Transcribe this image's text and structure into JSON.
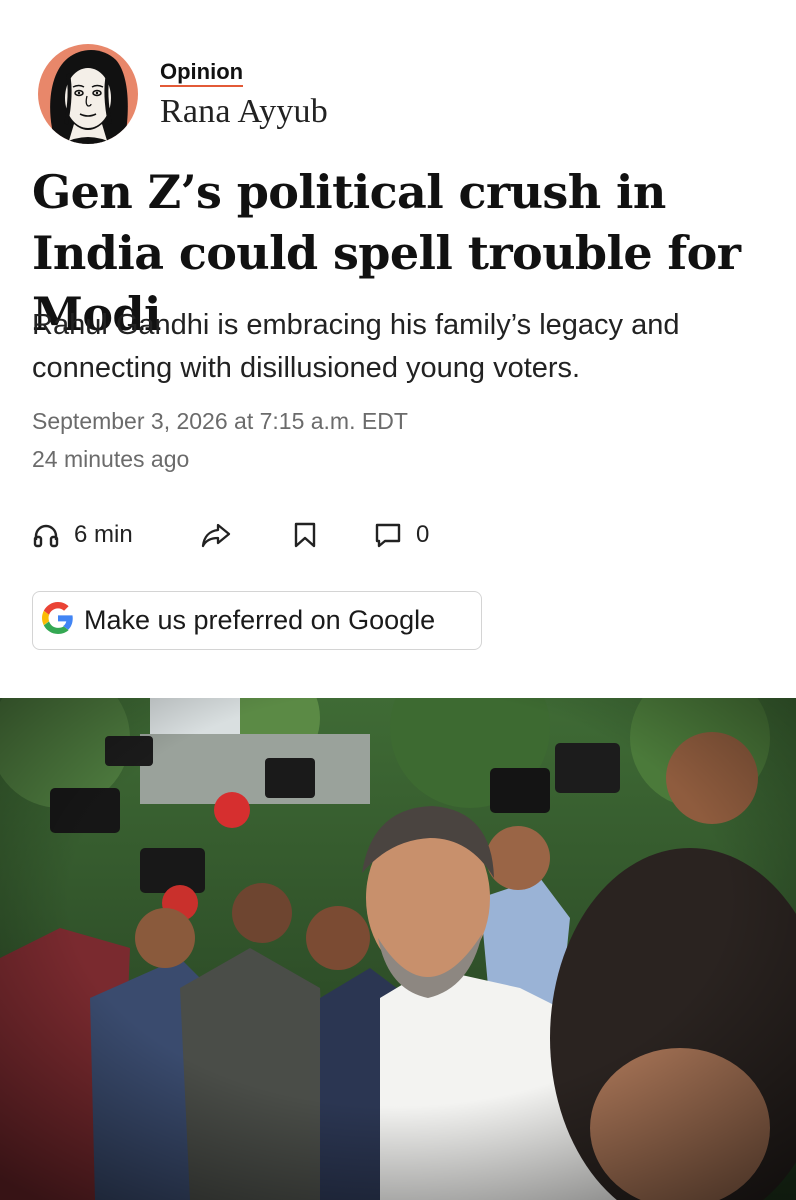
{
  "byline": {
    "section_label": "Opinion",
    "author_name": "Rana Ayyub"
  },
  "article": {
    "headline": "Gen Z’s political crush in India could spell trouble for Modi",
    "dek": "Rahul Gandhi is embracing his family’s legacy and connecting with disillusioned young voters.",
    "published": "September 3, 2026 at 7:15 a.m. EDT",
    "relative_time": "24 minutes ago"
  },
  "actions": {
    "listen_duration": "6 min",
    "comment_count": "0",
    "icons": [
      "headphones-icon",
      "share-icon",
      "bookmark-icon",
      "comment-icon"
    ]
  },
  "google_button": {
    "label": "Make us preferred on Google",
    "icon": "google-g-icon"
  },
  "colors": {
    "opinion_underline": "#e35a37",
    "avatar_background": "#e8876a",
    "meta_text": "#6b6b6b",
    "google_blue": "#4285F4",
    "google_red": "#EA4335",
    "google_yellow": "#FBBC05",
    "google_green": "#34A853"
  }
}
